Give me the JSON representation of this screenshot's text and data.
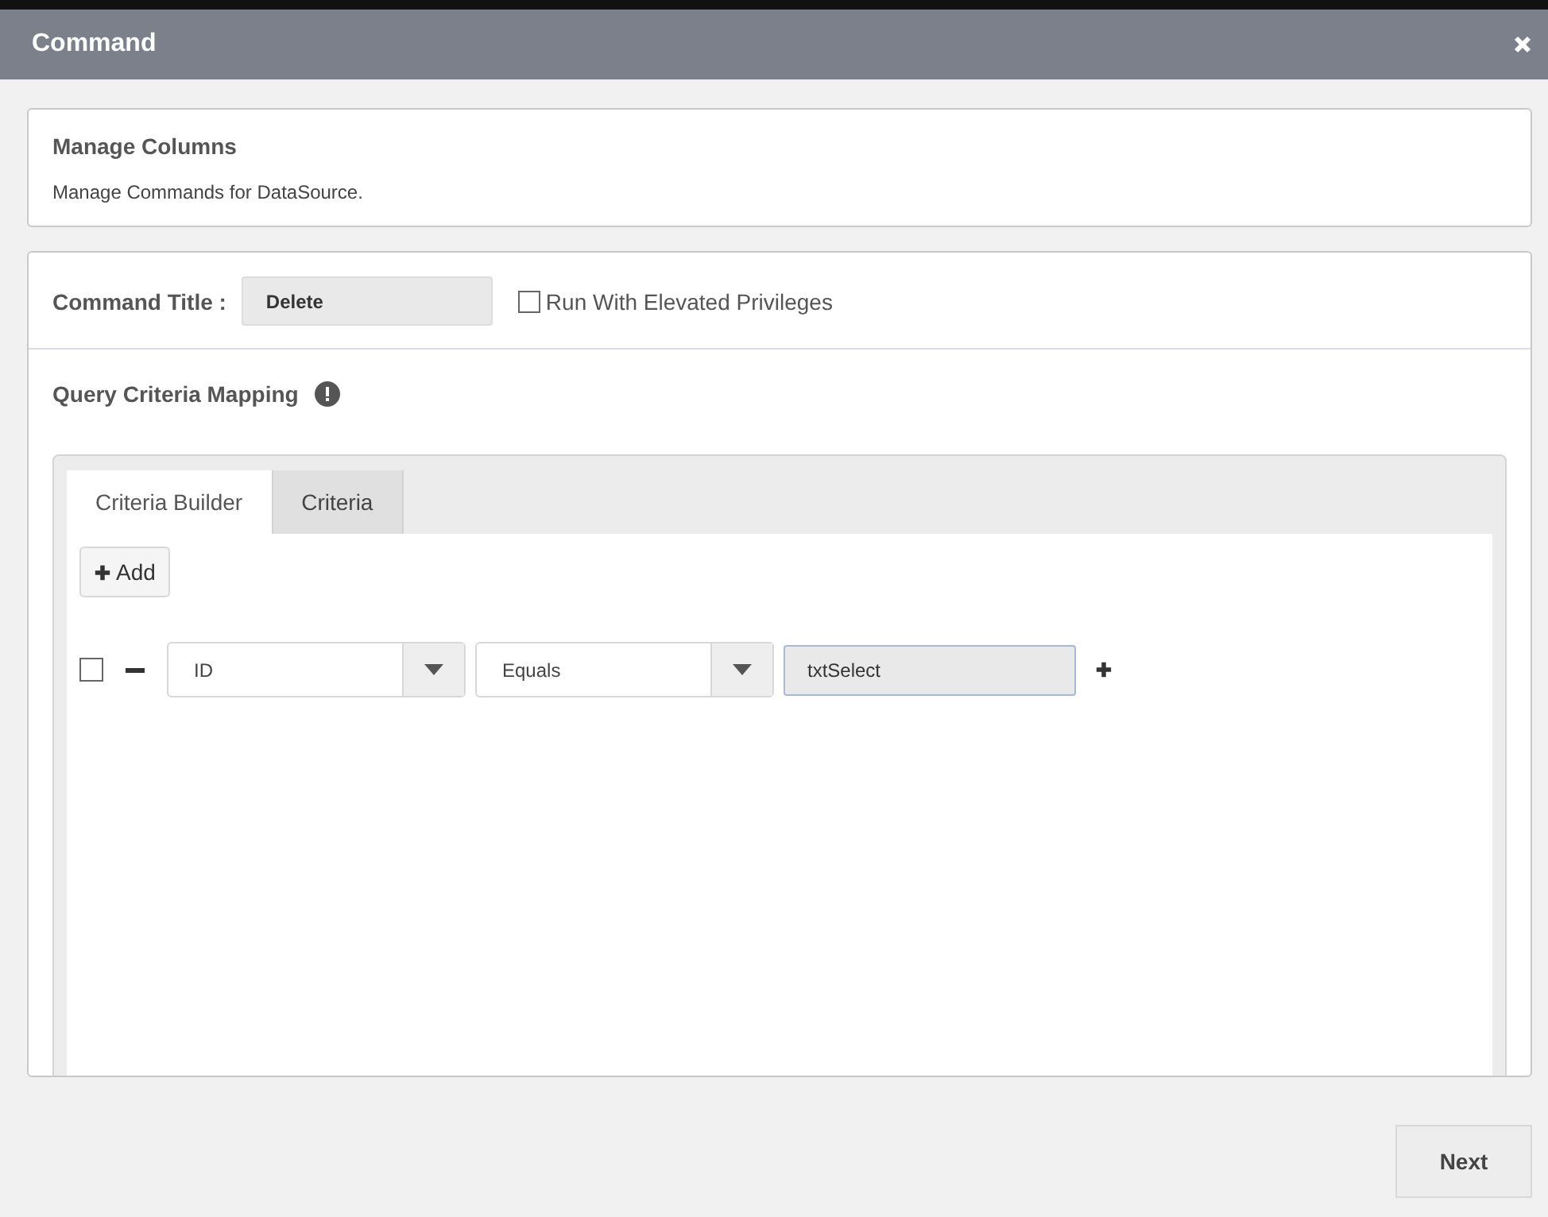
{
  "window": {
    "title": "Command"
  },
  "header_card": {
    "title": "Manage Columns",
    "description": "Manage Commands for DataSource."
  },
  "command": {
    "label": "Command Title :",
    "value": "Delete",
    "elevated": {
      "label": "Run With Elevated Privileges",
      "checked": false
    }
  },
  "mapping": {
    "title": "Query Criteria Mapping",
    "tabs": [
      {
        "label": "Criteria Builder",
        "selected": true
      },
      {
        "label": "Criteria",
        "selected": false
      }
    ],
    "add_button": "Add",
    "rows": [
      {
        "checked": false,
        "field": "ID",
        "operator": "Equals",
        "value": "txtSelect"
      }
    ]
  },
  "footer": {
    "next": "Next"
  }
}
